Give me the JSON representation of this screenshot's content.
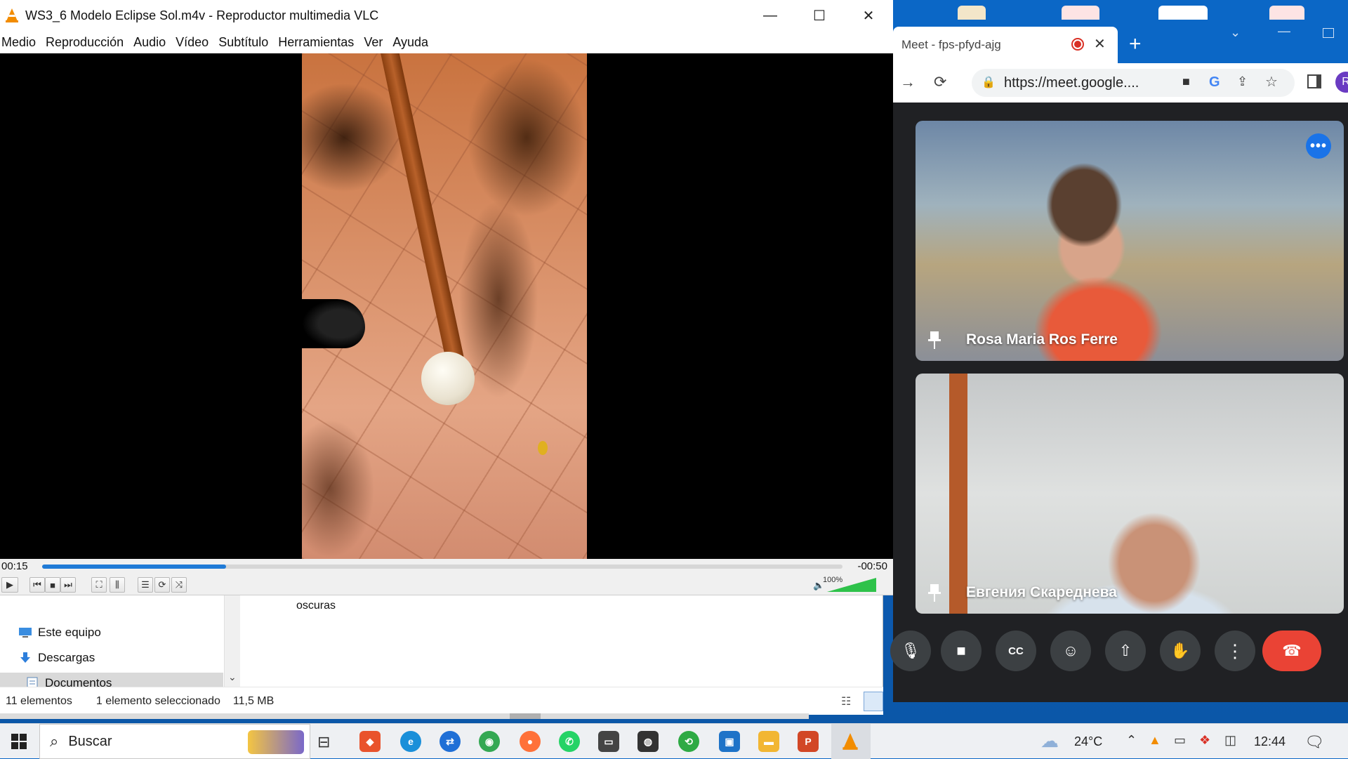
{
  "vlc": {
    "title": "WS3_6 Modelo Eclipse Sol.m4v - Reproductor multimedia VLC",
    "menu": [
      "Medio",
      "Reproducción",
      "Audio",
      "Vídeo",
      "Subtítulo",
      "Herramientas",
      "Ver",
      "Ayuda"
    ],
    "time_elapsed": "00:15",
    "time_remaining": "-00:50",
    "progress_fraction": 0.23,
    "volume_label": "100%",
    "volume_fraction": 1.0,
    "window_controls": {
      "minimize": "—",
      "maximize": "☐",
      "close": "✕"
    }
  },
  "explorer": {
    "nav_items": [
      "Este equipo",
      "Descargas",
      "Documentos"
    ],
    "selected_nav": "Documentos",
    "detail_text": "oscuras",
    "status": {
      "count": "11 elementos",
      "selection": "1 elemento seleccionado",
      "size": "11,5 MB"
    }
  },
  "chrome": {
    "tab_title": "Meet - fps-pfyd-ajg",
    "url": "https://meet.google....",
    "profile_initial": "R"
  },
  "meet": {
    "participants": [
      {
        "name": "Rosa Maria Ros Ferre"
      },
      {
        "name": "Евгения Скареднева"
      }
    ],
    "menu_dots": "•••"
  },
  "taskbar": {
    "search_placeholder": "Buscar",
    "weather": "24°C",
    "time": "12:44"
  },
  "colors": {
    "vlc_accent": "#1f7ad6",
    "meet_end": "#ea4335",
    "meet_button": "#3c4043",
    "volume_fill": "#2ec24a"
  }
}
